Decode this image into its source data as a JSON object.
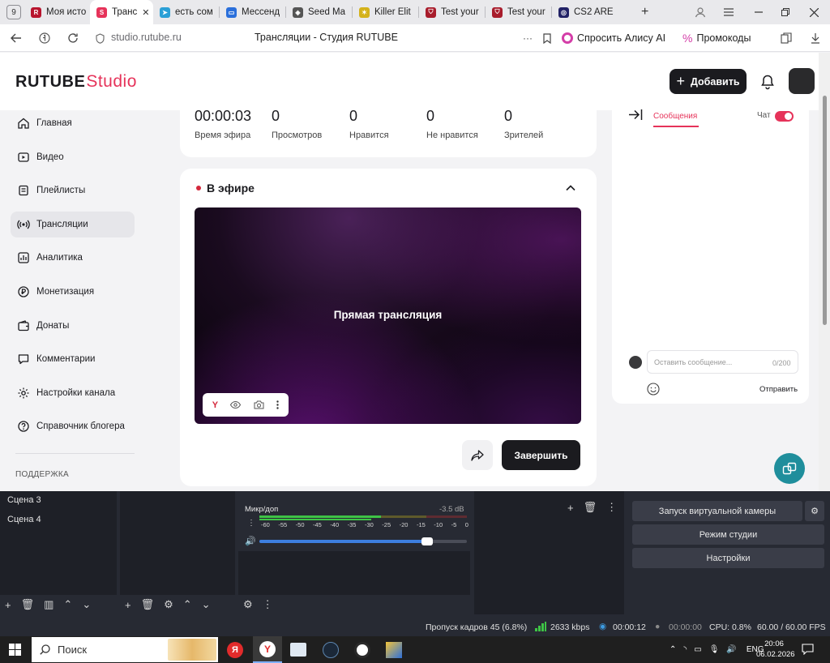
{
  "browser": {
    "tab_count": "9",
    "tabs": [
      {
        "label": "Моя исто",
        "color": "#b8142e",
        "glyph": "R"
      },
      {
        "label": "Транс",
        "color": "#e6335a",
        "glyph": "S"
      },
      {
        "label": "есть сом",
        "color": "#2a9fd6",
        "glyph": "➤"
      },
      {
        "label": "Мессенд",
        "color": "#2a6fdb",
        "glyph": "▭"
      },
      {
        "label": "Seed Ma",
        "color": "#555555",
        "glyph": "◈"
      },
      {
        "label": "Killer Elit",
        "color": "#d4b21a",
        "glyph": "✶"
      },
      {
        "label": "Test your",
        "color": "#a81c2c",
        "glyph": "⛉"
      },
      {
        "label": "Test your",
        "color": "#a81c2c",
        "glyph": "⛉"
      },
      {
        "label": "CS2 ARE",
        "color": "#222266",
        "glyph": "◎"
      }
    ],
    "close_glyph": "✕",
    "new_tab_glyph": "+",
    "url": "studio.rutube.ru",
    "page_title": "Трансляции - Студия RUTUBE",
    "menu_dots": "···",
    "alice_label": "Спросить Алису AI",
    "promo_label": "Промокоды"
  },
  "header": {
    "logo_main": "RUTUBE",
    "logo_studio": "Studio",
    "add_label": "Добавить"
  },
  "sidebar": {
    "items": [
      {
        "label": "Главная",
        "icon": "home-icon"
      },
      {
        "label": "Видео",
        "icon": "video-icon"
      },
      {
        "label": "Плейлисты",
        "icon": "playlist-icon"
      },
      {
        "label": "Трансляции",
        "icon": "broadcast-icon"
      },
      {
        "label": "Аналитика",
        "icon": "analytics-icon"
      },
      {
        "label": "Монетизация",
        "icon": "monetization-icon"
      },
      {
        "label": "Донаты",
        "icon": "wallet-icon"
      },
      {
        "label": "Комментарии",
        "icon": "comment-icon"
      },
      {
        "label": "Настройки канала",
        "icon": "gear-icon"
      },
      {
        "label": "Справочник блогера",
        "icon": "help-icon"
      }
    ],
    "support": "ПОДДЕРЖКА"
  },
  "stats": [
    {
      "value": "00:00:03",
      "label": "Время эфира"
    },
    {
      "value": "0",
      "label": "Просмотров"
    },
    {
      "value": "0",
      "label": "Нравится"
    },
    {
      "value": "0",
      "label": "Не нравится"
    },
    {
      "value": "0",
      "label": "Зрителей"
    }
  ],
  "live": {
    "title": "В эфире",
    "player_text": "Прямая трансляция",
    "end_label": "Завершить",
    "player_y_label": "Y"
  },
  "chat": {
    "tab_messages": "Сообщения",
    "chat_label": "Чат",
    "input_placeholder": "Оставить сообщение...",
    "counter": "0/200",
    "send_label": "Отправить"
  },
  "obs": {
    "scenes": [
      "Сцена 3",
      "Сцена 4"
    ],
    "mixer_label": "Микр/доп",
    "mixer_db": "-3.5 dB",
    "meter_ticks": [
      "-60",
      "-55",
      "-50",
      "-45",
      "-40",
      "-35",
      "-30",
      "-25",
      "-20",
      "-15",
      "-10",
      "-5",
      "0"
    ],
    "volume_level": 0.81,
    "buttons": [
      "Запуск виртуальной камеры",
      "Режим студии",
      "Настройки"
    ]
  },
  "status": {
    "dropped": "Пропуск кадров 45 (6.8%)",
    "kbps": "2633 kbps",
    "stream_time": "00:00:12",
    "rec_time": "00:00:00",
    "cpu": "CPU: 0.8%",
    "fps": "60.00 / 60.00 FPS"
  },
  "taskbar": {
    "search": "Поиск",
    "lang": "ENG",
    "time": "20:06",
    "date": "06.02.2026"
  },
  "colors": {
    "accent": "#e6335a",
    "fab": "#1f8e9c"
  }
}
